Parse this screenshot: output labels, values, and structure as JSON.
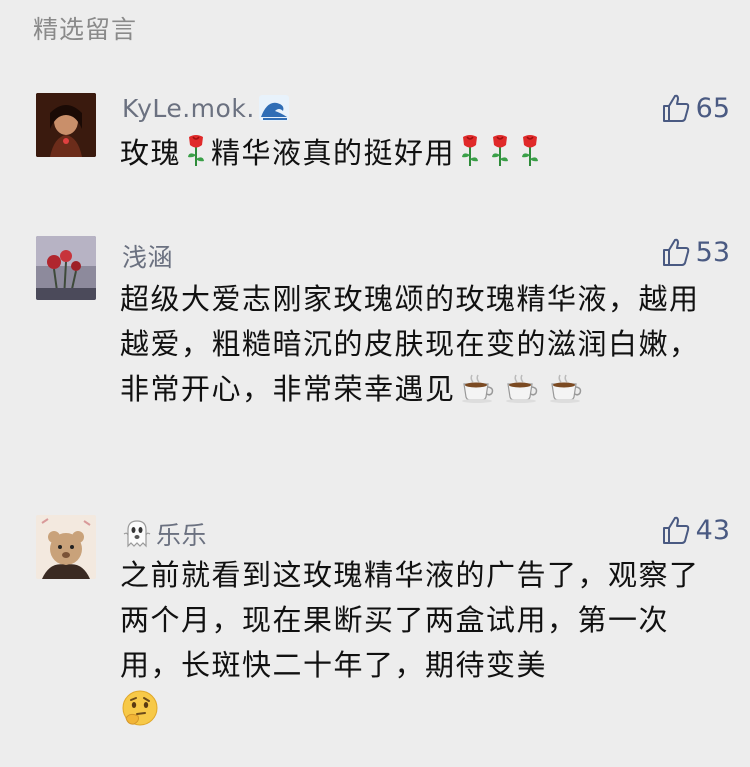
{
  "section": {
    "title": "精选留言"
  },
  "comments": [
    {
      "name": "KyLe.mok.",
      "name_emoji": "wave-icon",
      "likes": "65",
      "text_parts": [
        "玫瑰",
        "精华液真的挺好用"
      ],
      "emoji_name": "rose-icon"
    },
    {
      "name": "浅涵",
      "likes": "53",
      "text": "超级大爱志刚家玫瑰颂的玫瑰精华液，越用越爱，粗糙暗沉的皮肤现在变的滋润白嫩，非常开心，非常荣幸遇见",
      "emoji_name": "coffee-icon"
    },
    {
      "name": "乐乐",
      "name_emoji": "ghost-icon",
      "likes": "43",
      "text": "之前就看到这玫瑰精华液的广告了，观察了两个月，现在果断买了两盒试用，第一次用，长斑快二十年了，期待变美",
      "emoji_name": "thinking-face-icon"
    }
  ],
  "colors": {
    "background": "#ededed",
    "name": "#6b7180",
    "likes": "#4a5a82",
    "text": "#111111"
  }
}
